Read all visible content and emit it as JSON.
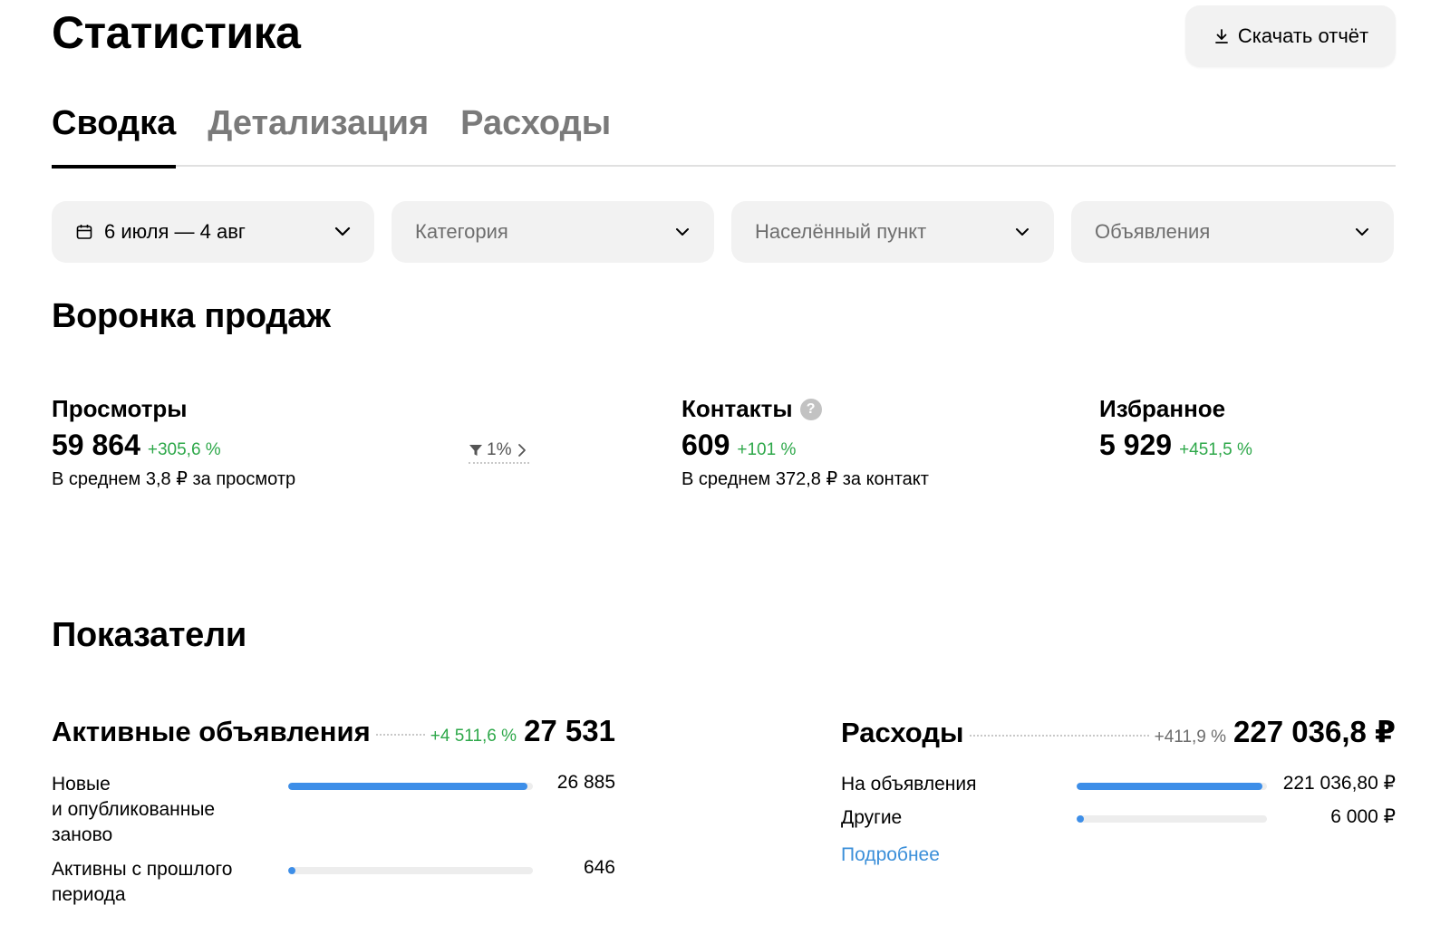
{
  "header": {
    "title": "Статистика",
    "download_label": "Скачать отчёт"
  },
  "tabs": [
    {
      "label": "Сводка",
      "active": true
    },
    {
      "label": "Детализация",
      "active": false
    },
    {
      "label": "Расходы",
      "active": false
    }
  ],
  "filters": {
    "date": "6 июля — 4 авг",
    "category": "Категория",
    "locality": "Населённый пункт",
    "ads": "Объявления"
  },
  "funnel": {
    "title": "Воронка продаж",
    "views": {
      "label": "Просмотры",
      "value": "59 864",
      "delta": "+305,6 %",
      "sub": "В среднем 3,8 ₽ за просмотр"
    },
    "conversion": "1%",
    "contacts": {
      "label": "Контакты",
      "help": "?",
      "value": "609",
      "delta": "+101 %",
      "sub": "В среднем 372,8 ₽ за контакт"
    },
    "favorites": {
      "label": "Избранное",
      "value": "5 929",
      "delta": "+451,5 %"
    }
  },
  "indicators": {
    "title": "Показатели",
    "active_ads": {
      "label": "Активные объявления",
      "delta": "+4 511,6 %",
      "value": "27 531",
      "rows": [
        {
          "label_lines": [
            "Новые",
            "и опубликованные",
            "заново"
          ],
          "value": "26 885",
          "fraction": 0.976
        },
        {
          "label_lines": [
            "Активны с прошлого",
            "периода"
          ],
          "value": "646",
          "fraction": 0.024
        }
      ]
    },
    "expenses": {
      "label": "Расходы",
      "delta": "+411,9 %",
      "value": "227 036,8 ₽",
      "rows": [
        {
          "label": "На объявления",
          "value": "221 036,80 ₽",
          "fraction": 0.974
        },
        {
          "label": "Другие",
          "value": "6 000 ₽",
          "fraction": 0.026
        }
      ],
      "more_link": "Подробнее"
    }
  },
  "colors": {
    "accent_bar": "#3d8ee8",
    "positive_delta": "#2ea84a",
    "link": "#3b8fd9"
  }
}
